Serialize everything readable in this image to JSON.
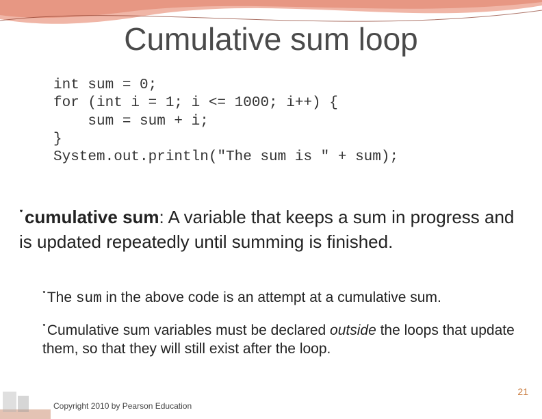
{
  "title": "Cumulative sum loop",
  "code": "int sum = 0;\nfor (int i = 1; i <= 1000; i++) {\n    sum = sum + i;\n}\nSystem.out.println(\"The sum is \" + sum);",
  "bullet_glyph": "་",
  "para1": {
    "term": "cumulative sum",
    "rest": ": A variable that keeps a sum in progress and is updated repeatedly until summing is finished."
  },
  "para2": {
    "pre": "The ",
    "code": "sum",
    "post": " in the above code is an attempt at a cumulative sum."
  },
  "para3": {
    "pre": "Cumulative sum variables must be declared ",
    "italic": "outside",
    "post": " the loops that update them, so that they will still exist after the loop."
  },
  "page_number": "21",
  "copyright": "Copyright 2010 by Pearson Education"
}
